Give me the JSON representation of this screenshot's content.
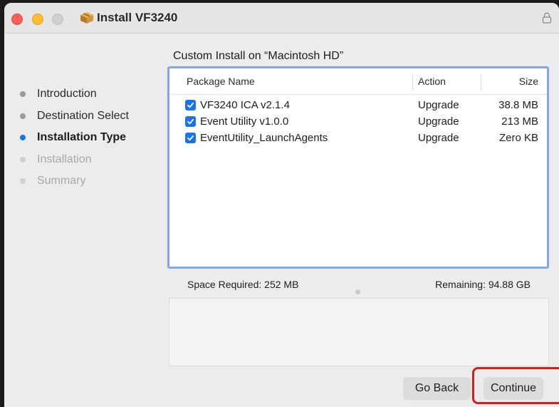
{
  "window": {
    "title": "Install VF3240"
  },
  "sidebar": {
    "items": [
      {
        "label": "Introduction",
        "state": "done"
      },
      {
        "label": "Destination Select",
        "state": "done"
      },
      {
        "label": "Installation Type",
        "state": "active"
      },
      {
        "label": "Installation",
        "state": "pending"
      },
      {
        "label": "Summary",
        "state": "pending"
      }
    ]
  },
  "main": {
    "heading": "Custom Install on “Macintosh HD”",
    "table": {
      "columns": [
        "Package Name",
        "Action",
        "Size"
      ],
      "rows": [
        {
          "name": "VF3240 ICA v2.1.4",
          "action": "Upgrade",
          "size": "38.8 MB",
          "checked": true
        },
        {
          "name": "Event Utility v1.0.0",
          "action": "Upgrade",
          "size": "213 MB",
          "checked": true
        },
        {
          "name": "EventUtility_LaunchAgents",
          "action": "Upgrade",
          "size": "Zero KB",
          "checked": true
        }
      ]
    },
    "space_required": "Space Required:  252 MB",
    "remaining": "Remaining:  94.88 GB"
  },
  "buttons": {
    "back": "Go Back",
    "continue": "Continue"
  },
  "colors": {
    "accent": "#1a73e8",
    "highlight": "#d01f1f",
    "close": "#fe5f57",
    "minimize": "#febc2e"
  }
}
